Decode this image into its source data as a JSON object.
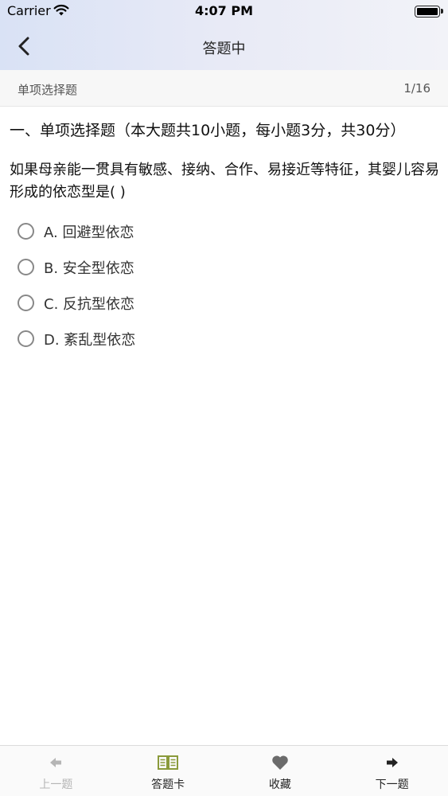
{
  "status_bar": {
    "carrier": "Carrier",
    "time": "4:07 PM"
  },
  "nav": {
    "title": "答题中",
    "back_icon": "chevron-left-icon"
  },
  "subheader": {
    "section": "单项选择题",
    "progress": "1/16"
  },
  "question": {
    "section_heading": "一、单项选择题（本大题共10小题，每小题3分，共30分）",
    "text": "如果母亲能一贯具有敏感、接纳、合作、易接近等特征，其婴儿容易形成的依恋型是(    )",
    "options": [
      {
        "label": "A. 回避型依恋"
      },
      {
        "label": "B. 安全型依恋"
      },
      {
        "label": "C. 反抗型依恋"
      },
      {
        "label": "D. 紊乱型依恋"
      }
    ]
  },
  "tabbar": {
    "items": [
      {
        "label": "上一题",
        "icon": "arrow-left-icon",
        "state": "disabled"
      },
      {
        "label": "答题卡",
        "icon": "book-icon",
        "state": "enabled"
      },
      {
        "label": "收藏",
        "icon": "heart-icon",
        "state": "enabled"
      },
      {
        "label": "下一题",
        "icon": "arrow-right-icon",
        "state": "enabled"
      }
    ]
  },
  "colors": {
    "header_gradient_start": "#d9e2f5",
    "header_gradient_end": "#f2f3f8",
    "book_icon": "#8a9a3a",
    "heart_icon": "#6b6b6b",
    "disabled_text": "#b5b5b5"
  }
}
